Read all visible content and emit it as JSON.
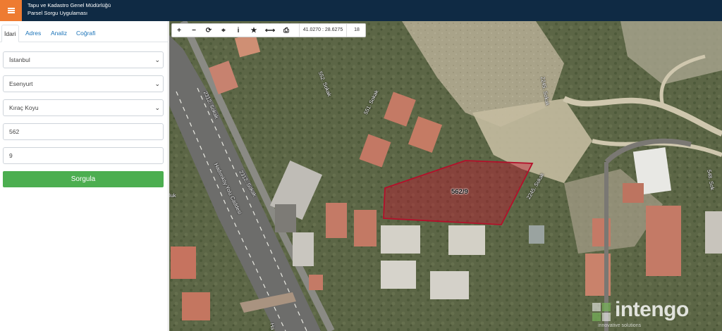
{
  "header": {
    "title": "Tapu ve Kadastro Genel Müdürlüğü",
    "subtitle": "Parsel Sorgu Uygulaması",
    "menu_icon": "hamburger-icon",
    "accent_color": "#ee7b31",
    "bg_color": "#0f2a44"
  },
  "sidebar": {
    "tabs": [
      {
        "label": "İdari"
      },
      {
        "label": "Adres"
      },
      {
        "label": "Analiz"
      },
      {
        "label": "Coğrafi"
      }
    ],
    "selects": [
      {
        "value": "İstanbul"
      },
      {
        "value": "Esenyurt"
      },
      {
        "value": "Kıraç Koyu"
      }
    ],
    "inputs": [
      {
        "value": "562"
      },
      {
        "value": "9"
      }
    ],
    "submit_label": "Sorgula",
    "submit_color": "#4cae50"
  },
  "toolbar": {
    "buttons": [
      {
        "icon": "zoom-in-icon",
        "glyph": "+"
      },
      {
        "icon": "zoom-out-icon",
        "glyph": "−"
      },
      {
        "icon": "refresh-icon",
        "glyph": "⟳"
      },
      {
        "icon": "locate-icon",
        "glyph": "⌖"
      },
      {
        "icon": "info-icon",
        "glyph": "i"
      },
      {
        "icon": "star-icon",
        "glyph": "★"
      },
      {
        "icon": "measure-icon",
        "glyph": "⟷"
      },
      {
        "icon": "print-icon",
        "glyph": "⎙"
      }
    ],
    "coordinates": "41.0270 : 28.6275",
    "zoom_level": "18"
  },
  "map": {
    "streets": [
      {
        "label": "552. Sokak"
      },
      {
        "label": "2312. Sokak"
      },
      {
        "label": "551. Sokak"
      },
      {
        "label": "2245. Sokak"
      },
      {
        "label": "2312. Sokak"
      },
      {
        "label": "Hadımköy Yolu Caddesi"
      },
      {
        "label": "2245. Sokak"
      },
      {
        "label": "548. Sok"
      },
      {
        "label": "luk"
      },
      {
        "label": "Ha"
      }
    ],
    "parcel_label": "562/9",
    "parcel_color": "#c8102e"
  },
  "watermark": {
    "brand": "intengo",
    "tagline": "innovative solutions"
  }
}
